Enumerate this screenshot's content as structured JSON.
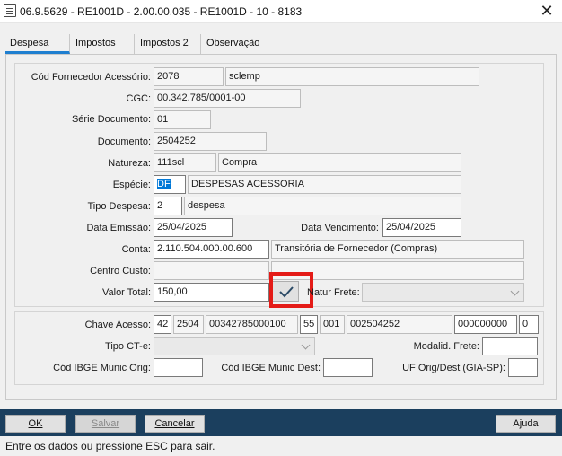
{
  "window": {
    "title": "06.9.5629 - RE1001D - 2.00.00.035 - RE1001D - 10 - 8183",
    "close_glyph": "✕"
  },
  "tabs": [
    {
      "label": "Despesa",
      "active": true
    },
    {
      "label": "Impostos",
      "active": false
    },
    {
      "label": "Impostos 2",
      "active": false
    },
    {
      "label": "Observação",
      "active": false
    }
  ],
  "form": {
    "fornecedor": {
      "label": "Cód Fornecedor Acessório:",
      "code": "2078",
      "name": "sclemp"
    },
    "cgc": {
      "label": "CGC:",
      "value": "00.342.785/0001-00"
    },
    "serie": {
      "label": "Série Documento:",
      "value": "01"
    },
    "documento": {
      "label": "Documento:",
      "value": "2504252"
    },
    "natureza": {
      "label": "Natureza:",
      "code": "111scl",
      "desc": "Compra"
    },
    "especie": {
      "label": "Espécie:",
      "code": "DF",
      "desc": "DESPESAS ACESSORIA"
    },
    "tipo_despesa": {
      "label": "Tipo Despesa:",
      "code": "2",
      "desc": "despesa"
    },
    "data_emissao": {
      "label": "Data Emissão:",
      "value": "25/04/2025"
    },
    "data_vencimento": {
      "label": "Data Vencimento:",
      "value": "25/04/2025"
    },
    "conta": {
      "label": "Conta:",
      "code": "2.110.504.000.00.600",
      "desc": "Transitória de Fornecedor (Compras)"
    },
    "centro_custo": {
      "label": "Centro Custo:",
      "code": "",
      "desc": ""
    },
    "valor_total": {
      "label": "Valor Total:",
      "value": "150,00"
    },
    "natur_frete": {
      "label": "Natur Frete:",
      "value": ""
    }
  },
  "cte": {
    "chave": {
      "label": "Chave Acesso:",
      "parts": [
        "42",
        "2504",
        "00342785000100",
        "55",
        "001",
        "002504252",
        "000000000",
        "0"
      ]
    },
    "tipo_cte": {
      "label": "Tipo CT-e:",
      "value": ""
    },
    "modalid_frete": {
      "label": "Modalid. Frete:",
      "value": ""
    },
    "ibge_orig": {
      "label": "Cód IBGE Munic Orig:",
      "value": ""
    },
    "ibge_dest": {
      "label": "Cód IBGE Munic Dest:",
      "value": ""
    },
    "uf_orig_dest": {
      "label": "UF Orig/Dest (GIA-SP):",
      "value": ""
    }
  },
  "buttons": {
    "ok": "OK",
    "salvar": "Salvar",
    "cancelar": "Cancelar",
    "ajuda": "Ajuda"
  },
  "status": "Entre os dados ou pressione ESC para sair.",
  "colors": {
    "bottom_bar": "#1b3f5e",
    "tab_accent": "#1f7fd0",
    "highlight_box": "#e41b17",
    "selection": "#0078d7"
  },
  "icons": {
    "confirm": "check-icon",
    "close": "close-icon",
    "app": "app-window-icon"
  }
}
